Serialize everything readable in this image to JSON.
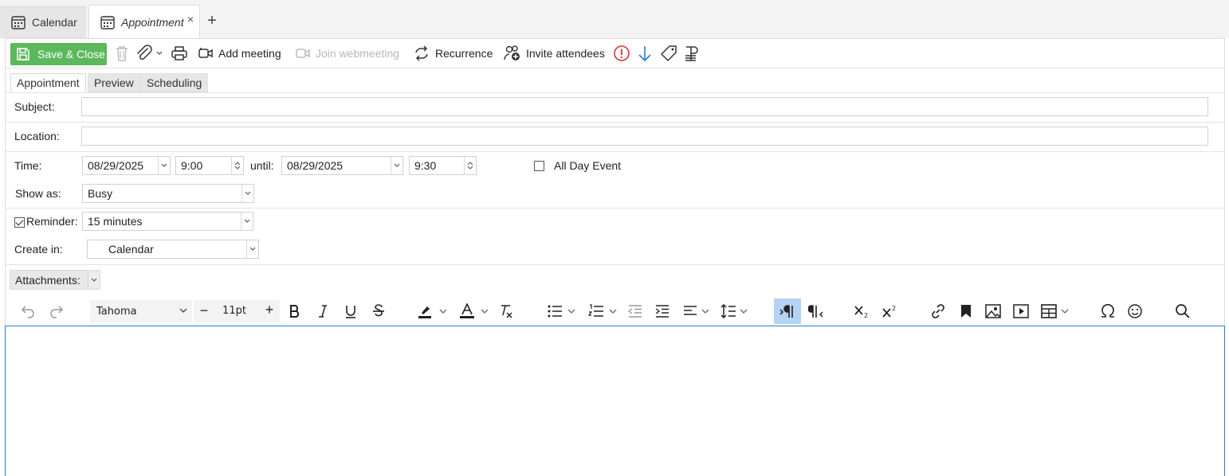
{
  "tabs": [
    {
      "label": "Calendar",
      "icon": "calendar-icon",
      "active": false
    },
    {
      "label": "Appointment",
      "icon": "calendar-icon",
      "active": true,
      "close": "×"
    }
  ],
  "add_tab": "+",
  "toolbar": {
    "save_close": "Save & Close",
    "add_meeting": "Add meeting",
    "join_webmeeting": "Join webmeeting",
    "recurrence": "Recurrence",
    "invite_attendees": "Invite attendees",
    "icons": [
      "save-icon",
      "trash-icon",
      "paperclip-icon",
      "printer-icon",
      "video-icon",
      "recurrence-icon",
      "invite-icon",
      "importance-high-icon",
      "importance-low-icon",
      "tag-icon",
      "coins-icon"
    ],
    "colors": {
      "save": "#5cb85c",
      "importance_high": "#d9342b",
      "importance_low": "#2a7bd3"
    }
  },
  "subtabs": [
    "Appointment",
    "Preview",
    "Scheduling"
  ],
  "form": {
    "subject_label": "Subject:",
    "subject_value": "",
    "location_label": "Location:",
    "location_value": "",
    "time_label": "Time:",
    "start_date": "08/29/2025",
    "start_time": "9:00",
    "until_label": "until:",
    "end_date": "08/29/2025",
    "end_time": "9:30",
    "all_day_label": "All Day Event",
    "all_day_checked": false,
    "show_as_label": "Show as:",
    "show_as_value": "Busy",
    "reminder_label": "Reminder:",
    "reminder_checked": true,
    "reminder_value": "15 minutes",
    "create_in_label": "Create in:",
    "create_in_value": "Calendar",
    "attachments_label": "Attachments:"
  },
  "editor": {
    "font_family": "Tahoma",
    "font_size": "11pt",
    "minus": "−",
    "plus": "+",
    "content": ""
  }
}
